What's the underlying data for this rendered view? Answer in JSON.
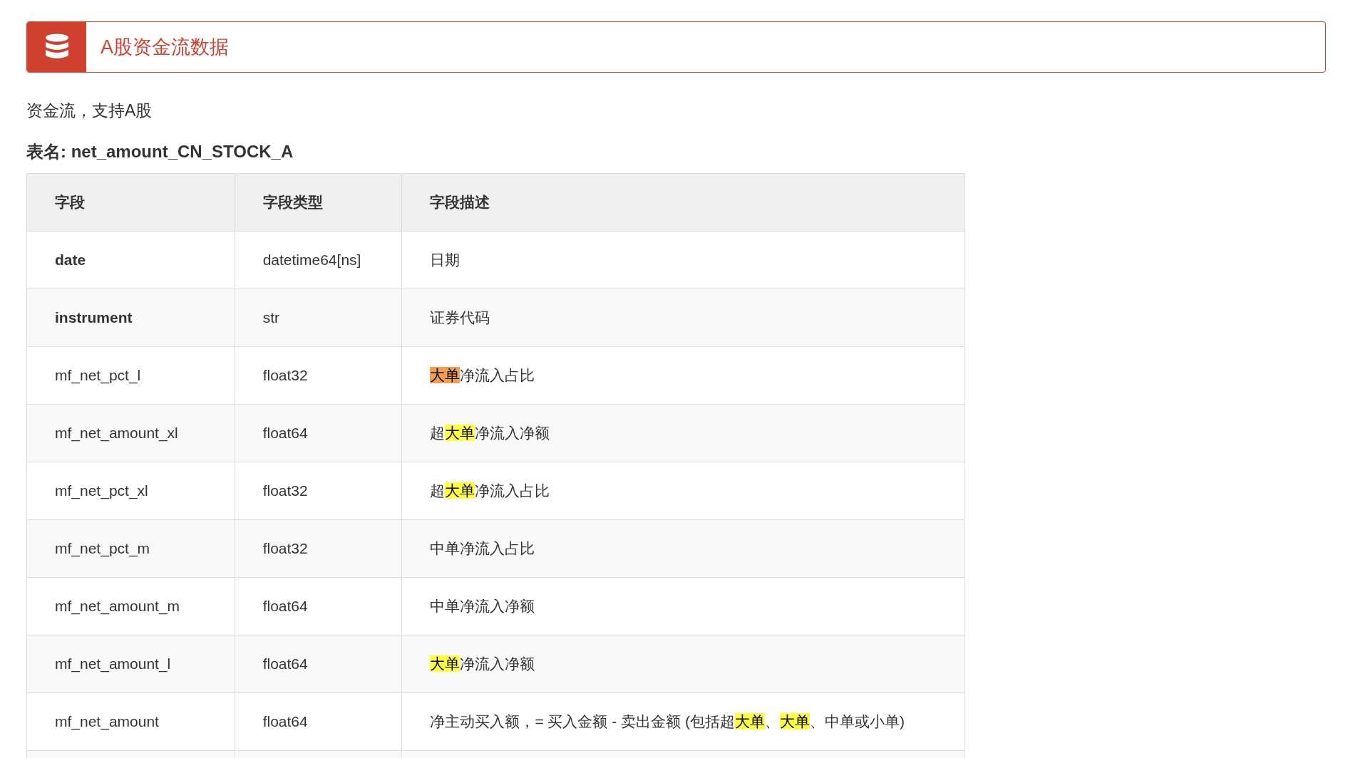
{
  "header": {
    "title": "A股资金流数据"
  },
  "description": "资金流，支持A股",
  "table_name": "表名: net_amount_CN_STOCK_A",
  "table": {
    "columns": [
      "字段",
      "字段类型",
      "字段描述"
    ],
    "rows": [
      {
        "field": "date",
        "bold": true,
        "type": "datetime64[ns]",
        "description": [
          {
            "text": "日期"
          }
        ]
      },
      {
        "field": "instrument",
        "bold": true,
        "type": "str",
        "description": [
          {
            "text": "证券代码"
          }
        ]
      },
      {
        "field": "mf_net_pct_l",
        "bold": false,
        "type": "float32",
        "description": [
          {
            "text": "大单",
            "color": "#f0a050"
          },
          {
            "text": "净流入占比"
          }
        ]
      },
      {
        "field": "mf_net_amount_xl",
        "bold": false,
        "type": "float64",
        "description": [
          {
            "text": "超"
          },
          {
            "text": "大单",
            "color": "#ffff40"
          },
          {
            "text": "净流入净额"
          }
        ]
      },
      {
        "field": "mf_net_pct_xl",
        "bold": false,
        "type": "float32",
        "description": [
          {
            "text": "超"
          },
          {
            "text": "大单",
            "color": "#ffff40"
          },
          {
            "text": "净流入占比"
          }
        ]
      },
      {
        "field": "mf_net_pct_m",
        "bold": false,
        "type": "float32",
        "description": [
          {
            "text": "中单净流入占比"
          }
        ]
      },
      {
        "field": "mf_net_amount_m",
        "bold": false,
        "type": "float64",
        "description": [
          {
            "text": "中单净流入净额"
          }
        ]
      },
      {
        "field": "mf_net_amount_l",
        "bold": false,
        "type": "float64",
        "description": [
          {
            "text": "大单",
            "color": "#ffff40"
          },
          {
            "text": "净流入净额"
          }
        ]
      },
      {
        "field": "mf_net_amount",
        "bold": false,
        "type": "float64",
        "description": [
          {
            "text": "净主动买入额，= 买入金额 - 卖出金额 (包括超"
          },
          {
            "text": "大单",
            "color": "#ffff40"
          },
          {
            "text": "、"
          },
          {
            "text": "大单",
            "color": "#ffff40"
          },
          {
            "text": "、中单或小单)"
          }
        ]
      }
    ]
  }
}
